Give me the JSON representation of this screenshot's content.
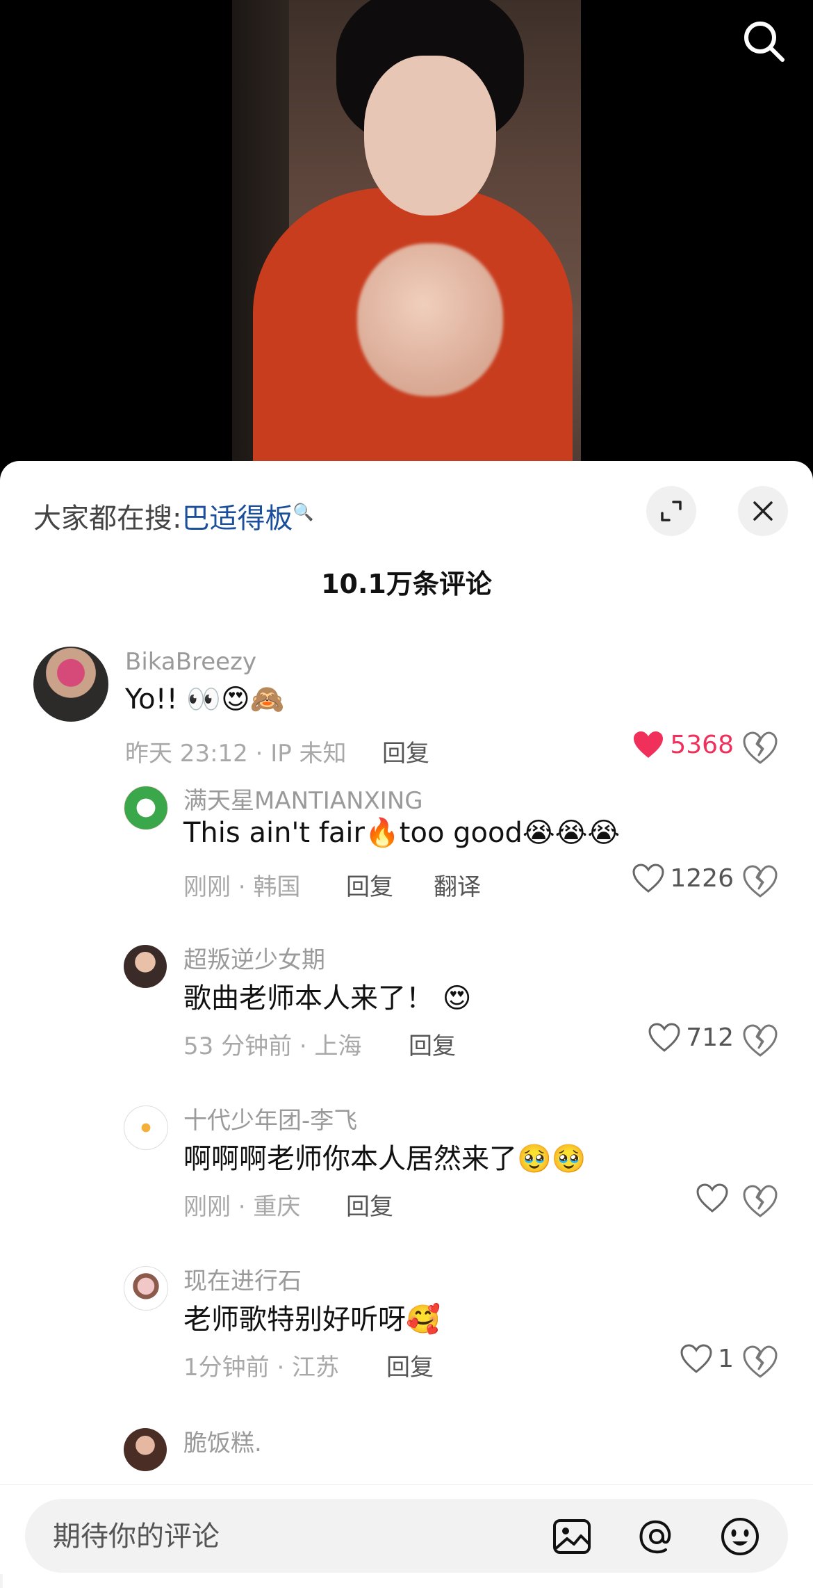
{
  "video": {
    "search_icon": "search-icon"
  },
  "sheet": {
    "trending_prefix": "大家都在搜:",
    "trending_term": "巴适得板",
    "comment_count": "10.1万条评论",
    "accent_color": "#f0305a",
    "link_color": "#1b4f9c"
  },
  "comments": [
    {
      "user": "BikaBreezy",
      "text": "Yo!! 👀😍🙈",
      "meta": "昨天 23:12 · IP 未知",
      "reply_label": "回复",
      "likes": "5368",
      "liked": true
    },
    {
      "user": "满天星MANTIANXING",
      "text": "This ain't fair🔥too good😭😭😭",
      "meta": "刚刚 · 韩国",
      "reply_label": "回复",
      "translate_label": "翻译",
      "likes": "1226"
    },
    {
      "user": "超叛逆少女期",
      "text": "歌曲老师本人来了！ 😍",
      "meta": "53 分钟前 · 上海",
      "reply_label": "回复",
      "likes": "712"
    },
    {
      "user": "十代少年团-李飞",
      "text": "啊啊啊老师你本人居然来了🥹🥹",
      "meta": "刚刚 · 重庆",
      "reply_label": "回复",
      "likes": ""
    },
    {
      "user": "现在进行石",
      "text": "老师歌特别好听呀🥰",
      "meta": "1分钟前 · 江苏",
      "reply_label": "回复",
      "likes": "1"
    },
    {
      "user": "脆饭糕."
    }
  ],
  "input": {
    "placeholder": "期待你的评论",
    "icons": [
      "image-icon",
      "at-icon",
      "emoji-icon"
    ]
  }
}
